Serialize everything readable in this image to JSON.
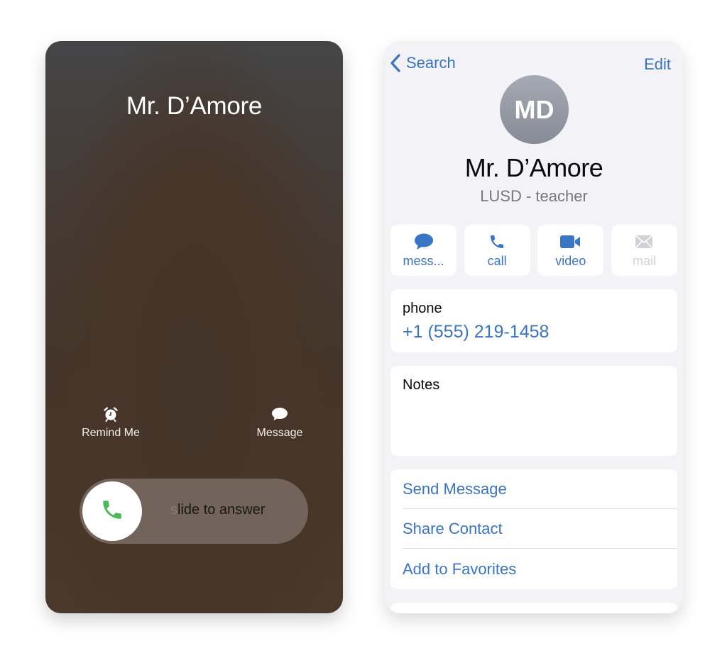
{
  "incoming_call": {
    "caller_name": "Mr. D’Amore",
    "quick_actions": [
      {
        "label": "Remind Me",
        "icon": "alarm-clock-icon"
      },
      {
        "label": "Message",
        "icon": "speech-bubble-icon"
      }
    ],
    "slider": {
      "label_faded": "s",
      "label": "lide to answer",
      "icon": "phone-icon",
      "icon_color": "#4cb85a"
    }
  },
  "contact": {
    "nav": {
      "back_label": "Search",
      "edit_label": "Edit"
    },
    "avatar_initials": "MD",
    "name": "Mr. D’Amore",
    "subtitle": "LUSD - teacher",
    "actions": [
      {
        "label": "mess...",
        "icon": "message-icon",
        "enabled": true
      },
      {
        "label": "call",
        "icon": "phone-icon",
        "enabled": true
      },
      {
        "label": "video",
        "icon": "video-camera-icon",
        "enabled": true
      },
      {
        "label": "mail",
        "icon": "envelope-icon",
        "enabled": false
      }
    ],
    "phone": {
      "label": "phone",
      "value": "+1 (555) 219-1458"
    },
    "notes": {
      "label": "Notes"
    },
    "options": [
      "Send Message",
      "Share Contact",
      "Add to Favorites"
    ]
  },
  "colors": {
    "accent": "#3a74c4",
    "disabled": "#d2d2d6",
    "answer_green": "#4cb85a",
    "grouped_background": "#f2f2f7"
  }
}
